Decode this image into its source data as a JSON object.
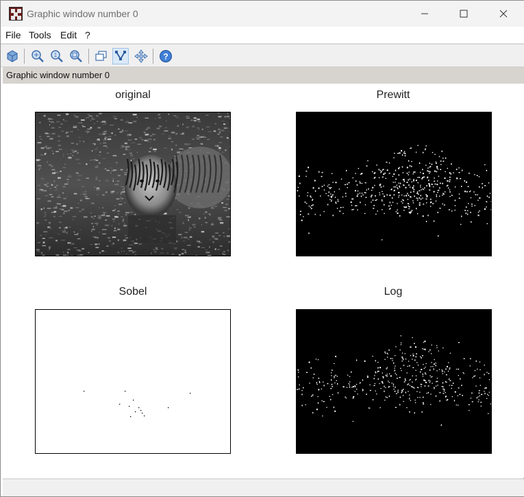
{
  "window": {
    "title": "Graphic window number 0",
    "minimize_glyph": "—",
    "maximize_glyph": "☐",
    "close_glyph": "✕"
  },
  "menu": {
    "items": [
      {
        "label": "File"
      },
      {
        "label": "Tools"
      },
      {
        "label": "Edit"
      },
      {
        "label": "?"
      }
    ]
  },
  "toolbar": {
    "icons": [
      "rotate-3d-icon",
      "zoom-in-icon",
      "zoom-original-icon",
      "zoom-region-icon",
      "new-window-icon",
      "datatip-icon",
      "pan-icon",
      "help-icon"
    ]
  },
  "info_bar": {
    "text": "Graphic window number 0"
  },
  "plots": [
    {
      "title": "original",
      "content": "grayscale tiger photo"
    },
    {
      "title": "Prewitt",
      "content": "edge map, white on black"
    },
    {
      "title": "Sobel",
      "content": "sparse edge map, black on white"
    },
    {
      "title": "Log",
      "content": "edge map, white on black"
    }
  ],
  "colors": {
    "info_bar_bg": "#d7d4cf",
    "title_bar_bg": "#f3f3f3",
    "toolbar_accent": "#3f7fd6"
  }
}
